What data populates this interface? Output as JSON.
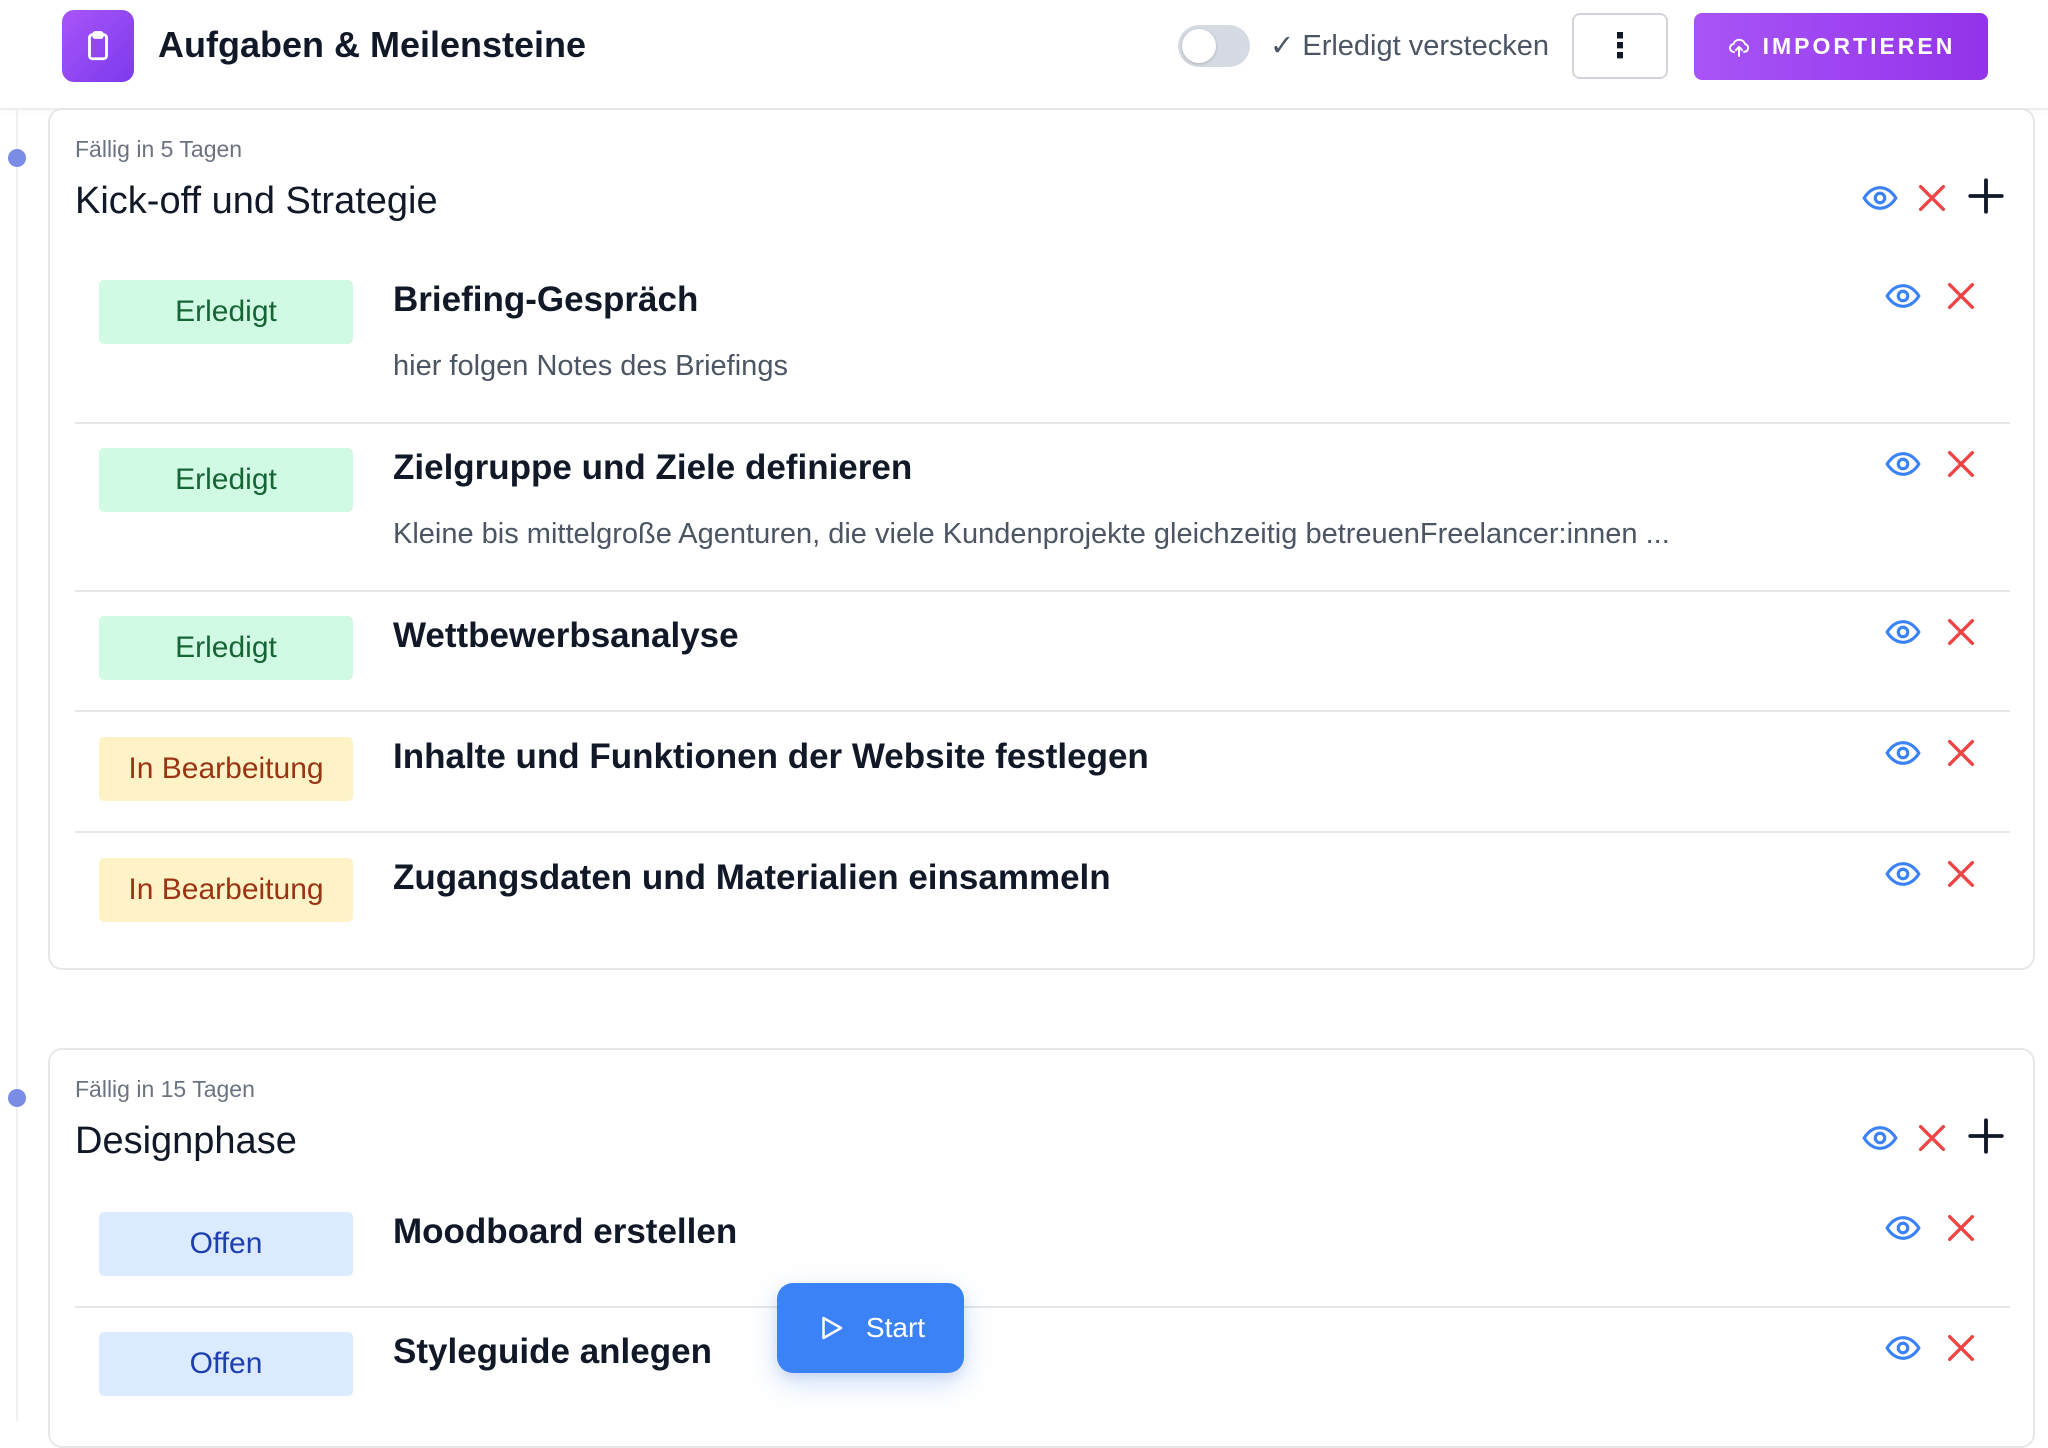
{
  "header": {
    "title": "Aufgaben & Meilensteine",
    "hide_done_label": "✓ Erledigt verstecken",
    "more_symbol": "⋮",
    "import_label": "IMPORTIEREN"
  },
  "milestones": [
    {
      "due": "Fällig in 5 Tagen",
      "title": "Kick-off und Strategie",
      "tasks": [
        {
          "status": "Erledigt",
          "title": "Briefing-Gespräch",
          "note": "hier folgen Notes des Briefings"
        },
        {
          "status": "Erledigt",
          "title": "Zielgruppe und Ziele definieren",
          "note": "Kleine bis mittelgroße Agenturen, die viele Kundenprojekte gleichzeitig betreuenFreelancer:innen ..."
        },
        {
          "status": "Erledigt",
          "title": "Wettbewerbsanalyse",
          "note": ""
        },
        {
          "status": "In Bearbeitung",
          "title": "Inhalte und Funktionen der Website festlegen",
          "note": ""
        },
        {
          "status": "In Bearbeitung",
          "title": "Zugangsdaten und Materialien einsammeln",
          "note": ""
        }
      ]
    },
    {
      "due": "Fällig in 15 Tagen",
      "title": "Designphase",
      "tasks": [
        {
          "status": "Offen",
          "title": "Moodboard erstellen",
          "note": ""
        },
        {
          "status": "Offen",
          "title": "Styleguide anlegen",
          "note": ""
        }
      ]
    }
  ],
  "start_button": {
    "label": "Start"
  },
  "colors": {
    "accent": "#9333ea",
    "done_bg": "#d1fae5",
    "progress_bg": "#fef3c7",
    "open_bg": "#dbeafe",
    "eye": "#3b82f6",
    "delete": "#ef4444"
  },
  "icons": {
    "app": "clipboard-icon",
    "view": "eye-icon",
    "delete": "close-icon",
    "add": "plus-icon",
    "import": "cloud-upload-icon",
    "start": "play-icon"
  }
}
